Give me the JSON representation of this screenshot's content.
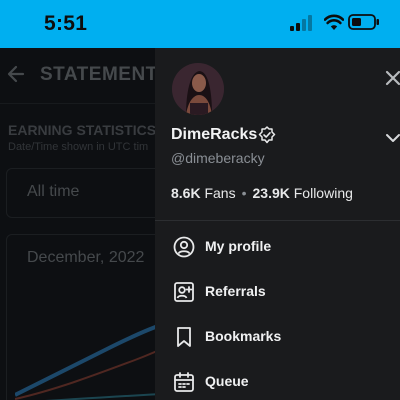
{
  "status_bar": {
    "time": "5:51",
    "background": "#00aff0"
  },
  "background_page": {
    "title": "STATEMENTS",
    "section_title": "EARNING STATISTICS",
    "section_subtitle": "Date/Time shown in UTC tim",
    "period_select": "All time",
    "chart_card_title": "December, 2022"
  },
  "drawer": {
    "display_name": "DimeRacks",
    "handle": "@dimeberacky",
    "fans_count": "8.6K",
    "fans_label": "Fans",
    "following_count": "23.9K",
    "following_label": "Following",
    "menu": [
      {
        "label": "My profile",
        "icon": "user-circle-icon"
      },
      {
        "label": "Referrals",
        "icon": "referral-user-icon"
      },
      {
        "label": "Bookmarks",
        "icon": "bookmark-icon"
      },
      {
        "label": "Queue",
        "icon": "calendar-icon"
      }
    ]
  }
}
